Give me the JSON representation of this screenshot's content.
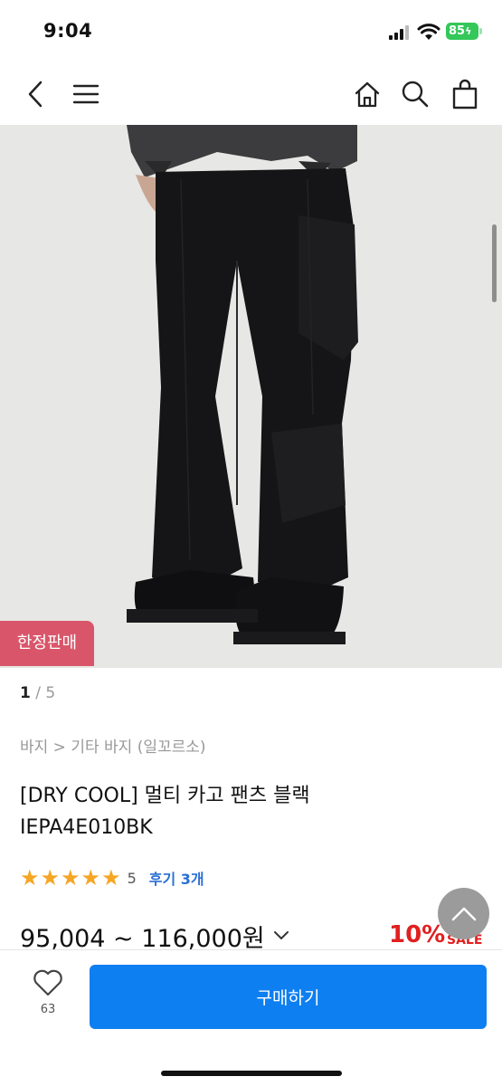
{
  "status_bar": {
    "time": "9:04",
    "battery": "85"
  },
  "nav": {
    "icons": [
      "back-icon",
      "menu-icon",
      "home-icon",
      "search-icon",
      "cart-icon"
    ]
  },
  "product_image": {
    "badge": "한정판매"
  },
  "pager": {
    "current": "1",
    "separator": " / ",
    "total": "5"
  },
  "breadcrumb": "바지 > 기타 바지 (일꼬르소)",
  "title": {
    "line1": "[DRY COOL] 멀티 카고 팬츠 블랙",
    "line2": "IEPA4E010BK"
  },
  "rating": {
    "stars": 5,
    "score": "5",
    "reviews": "후기 3개"
  },
  "price": {
    "range": "95,004 ~ 116,000원",
    "discount": "10%",
    "sale_label": "SALE"
  },
  "bottom_bar": {
    "wish_count": "63",
    "buy_label": "구매하기"
  },
  "colors": {
    "accent": "#0e7ff0",
    "badge": "#d9566a",
    "star": "#f5a623",
    "discount": "#e02020",
    "review_link": "#2b6fd6"
  }
}
